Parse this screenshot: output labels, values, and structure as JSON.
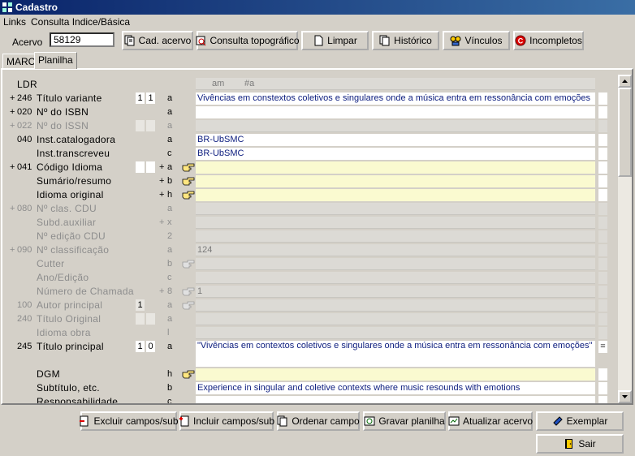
{
  "window": {
    "title": "Cadastro"
  },
  "menu": {
    "links": "Links",
    "consulta": "Consulta Indice/Básica"
  },
  "acervo": {
    "label": "Acervo",
    "value": "58129"
  },
  "toolbar": {
    "cad_acervo": "Cad. acervo",
    "consulta_topografico": "Consulta topográfico",
    "limpar": "Limpar",
    "historico": "Histórico",
    "vinculos": "Vínculos",
    "incompletos": "Incompletos"
  },
  "tabs": {
    "marc": "MARC",
    "planilha": "Planilha"
  },
  "grid": {
    "header_sub": "am",
    "header_hash": "#a",
    "rows": [
      {
        "plus": "",
        "tag": "",
        "label": "LDR",
        "ind1": "",
        "ind2": "",
        "splus": "",
        "sub": "",
        "value": "",
        "style": "header"
      },
      {
        "plus": "+",
        "tag": "246",
        "label": "Título variante",
        "ind1": "1",
        "ind2": "1",
        "splus": "",
        "sub": "a",
        "value": "Vivências em constextos coletivos e singulares onde a música entra em ressonância com emoções",
        "style": "white"
      },
      {
        "plus": "+",
        "tag": "020",
        "label": "Nº do ISBN",
        "ind1": "",
        "ind2": "",
        "splus": "",
        "sub": "a",
        "value": "",
        "style": "white"
      },
      {
        "plus": "+",
        "tag": "022",
        "label": "Nº do ISSN",
        "ind1": "",
        "ind2": "",
        "splus": "",
        "sub": "a",
        "value": "",
        "style": "grey",
        "dis": true
      },
      {
        "plus": "",
        "tag": "040",
        "label": "Inst.catalogadora",
        "ind1": "",
        "ind2": "",
        "splus": "",
        "sub": "a",
        "value": "BR-UbSMC",
        "style": "white"
      },
      {
        "plus": "",
        "tag": "",
        "label": "Inst.transcreveu",
        "ind1": "",
        "ind2": "",
        "splus": "",
        "sub": "c",
        "value": "BR-UbSMC",
        "style": "white"
      },
      {
        "plus": "+",
        "tag": "041",
        "label": "Código Idioma",
        "ind1": "",
        "ind2": "",
        "splus": "+",
        "sub": "a",
        "value": "",
        "style": "yellow",
        "hand": true
      },
      {
        "plus": "",
        "tag": "",
        "label": "Sumário/resumo",
        "ind1": "",
        "ind2": "",
        "splus": "+",
        "sub": "b",
        "value": "",
        "style": "yellow",
        "hand": true
      },
      {
        "plus": "",
        "tag": "",
        "label": "Idioma original",
        "ind1": "",
        "ind2": "",
        "splus": "+",
        "sub": "h",
        "value": "",
        "style": "yellow",
        "hand": true
      },
      {
        "plus": "+",
        "tag": "080",
        "label": "Nº clas. CDU",
        "ind1": "",
        "ind2": "",
        "splus": "",
        "sub": "a",
        "value": "",
        "style": "grey",
        "dis": true
      },
      {
        "plus": "",
        "tag": "",
        "label": "Subd.auxiliar",
        "ind1": "",
        "ind2": "",
        "splus": "+",
        "sub": "x",
        "value": "",
        "style": "grey",
        "dis": true
      },
      {
        "plus": "",
        "tag": "",
        "label": "Nº edição CDU",
        "ind1": "",
        "ind2": "",
        "splus": "",
        "sub": "2",
        "value": "",
        "style": "grey",
        "dis": true
      },
      {
        "plus": "+",
        "tag": "090",
        "label": "Nº classificação",
        "ind1": "",
        "ind2": "",
        "splus": "",
        "sub": "a",
        "value": "124",
        "style": "grey",
        "dis": true
      },
      {
        "plus": "",
        "tag": "",
        "label": "Cutter",
        "ind1": "",
        "ind2": "",
        "splus": "",
        "sub": "b",
        "value": "",
        "style": "grey",
        "dis": true,
        "hand": true
      },
      {
        "plus": "",
        "tag": "",
        "label": "Ano/Edição",
        "ind1": "",
        "ind2": "",
        "splus": "",
        "sub": "c",
        "value": "",
        "style": "grey",
        "dis": true
      },
      {
        "plus": "",
        "tag": "",
        "label": "Número de Chamada",
        "ind1": "",
        "ind2": "",
        "splus": "+",
        "sub": "8",
        "value": "1",
        "style": "grey",
        "dis": true,
        "hand": true
      },
      {
        "plus": "",
        "tag": "100",
        "label": "Autor principal",
        "ind1": "1",
        "ind2": "",
        "splus": "",
        "sub": "a",
        "value": "",
        "style": "grey",
        "dis": true,
        "hand": true
      },
      {
        "plus": "",
        "tag": "240",
        "label": "Título Original",
        "ind1": "",
        "ind2": "",
        "splus": "",
        "sub": "a",
        "value": "",
        "style": "grey",
        "dis": true
      },
      {
        "plus": "",
        "tag": "",
        "label": "Idioma obra",
        "ind1": "",
        "ind2": "",
        "splus": "",
        "sub": "l",
        "value": "",
        "style": "grey",
        "dis": true
      },
      {
        "plus": "",
        "tag": "245",
        "label": "Título principal",
        "ind1": "1",
        "ind2": "0",
        "splus": "",
        "sub": "a",
        "value": "\"Vivências em contextos coletivos e singulares onde a música entra em ressonância com emoções\"",
        "style": "white big",
        "tail": "="
      },
      {
        "plus": "",
        "tag": "",
        "label": "DGM",
        "ind1": "",
        "ind2": "",
        "splus": "",
        "sub": "h",
        "value": "",
        "style": "yellow",
        "hand": true
      },
      {
        "plus": "",
        "tag": "",
        "label": "Subtítulo, etc.",
        "ind1": "",
        "ind2": "",
        "splus": "",
        "sub": "b",
        "value": "Experience in singular and coletive contexts where music resounds with emotions",
        "style": "white"
      },
      {
        "plus": "",
        "tag": "",
        "label": "Responsabilidade",
        "ind1": "",
        "ind2": "",
        "splus": "",
        "sub": "c",
        "value": "",
        "style": "white"
      }
    ]
  },
  "bottom": {
    "excluir": "Excluir campos/sub",
    "incluir": "Incluir campos/sub",
    "ordenar": "Ordenar campo",
    "gravar": "Gravar planilha",
    "atualizar": "Atualizar acervo",
    "exemplar": "Exemplar",
    "sair": "Sair"
  }
}
